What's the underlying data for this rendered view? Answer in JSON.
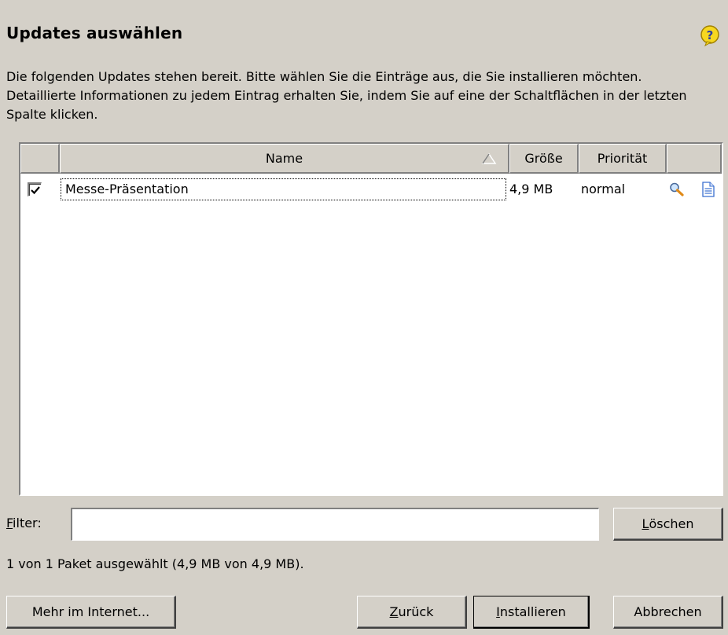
{
  "header": {
    "title": "Updates auswählen",
    "description": "Die folgenden Updates stehen bereit. Bitte wählen Sie die Einträge aus, die Sie installieren möchten. Detaillierte Informationen zu jedem Eintrag erhalten Sie, indem Sie auf eine der Schaltflächen in der letzten Spalte klicken."
  },
  "table": {
    "columns": [
      "",
      "Name",
      "Größe",
      "Priorität",
      ""
    ],
    "rows": [
      {
        "checked": true,
        "name": "Messe-Präsentation",
        "size": "4,9 MB",
        "priority": "normal",
        "icons": [
          "magnifier-icon",
          "document-icon"
        ]
      }
    ]
  },
  "filter": {
    "label_accel": "F",
    "label_rest": "ilter:",
    "value": "",
    "clear_accel": "L",
    "clear_rest": "öschen"
  },
  "status_text": "1 von 1 Paket ausgewählt (4,9 MB von 4,9 MB).",
  "buttons": {
    "more": "Mehr im Internet...",
    "back_accel": "Z",
    "back_rest": "urück",
    "install_accel": "I",
    "install_rest": "nstallieren",
    "cancel": "Abbrechen"
  },
  "colors": {
    "background": "#d4d0c8",
    "help_icon": "#f7d820",
    "magnifier": "#e08a18",
    "document": "#3a6fd0"
  }
}
